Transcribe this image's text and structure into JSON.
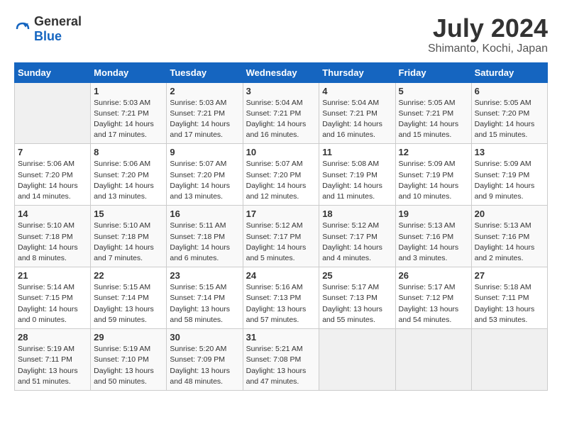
{
  "header": {
    "logo_general": "General",
    "logo_blue": "Blue",
    "title": "July 2024",
    "subtitle": "Shimanto, Kochi, Japan"
  },
  "calendar": {
    "days_of_week": [
      "Sunday",
      "Monday",
      "Tuesday",
      "Wednesday",
      "Thursday",
      "Friday",
      "Saturday"
    ],
    "weeks": [
      [
        {
          "day": "",
          "info": ""
        },
        {
          "day": "1",
          "info": "Sunrise: 5:03 AM\nSunset: 7:21 PM\nDaylight: 14 hours\nand 17 minutes."
        },
        {
          "day": "2",
          "info": "Sunrise: 5:03 AM\nSunset: 7:21 PM\nDaylight: 14 hours\nand 17 minutes."
        },
        {
          "day": "3",
          "info": "Sunrise: 5:04 AM\nSunset: 7:21 PM\nDaylight: 14 hours\nand 16 minutes."
        },
        {
          "day": "4",
          "info": "Sunrise: 5:04 AM\nSunset: 7:21 PM\nDaylight: 14 hours\nand 16 minutes."
        },
        {
          "day": "5",
          "info": "Sunrise: 5:05 AM\nSunset: 7:21 PM\nDaylight: 14 hours\nand 15 minutes."
        },
        {
          "day": "6",
          "info": "Sunrise: 5:05 AM\nSunset: 7:20 PM\nDaylight: 14 hours\nand 15 minutes."
        }
      ],
      [
        {
          "day": "7",
          "info": "Sunrise: 5:06 AM\nSunset: 7:20 PM\nDaylight: 14 hours\nand 14 minutes."
        },
        {
          "day": "8",
          "info": "Sunrise: 5:06 AM\nSunset: 7:20 PM\nDaylight: 14 hours\nand 13 minutes."
        },
        {
          "day": "9",
          "info": "Sunrise: 5:07 AM\nSunset: 7:20 PM\nDaylight: 14 hours\nand 13 minutes."
        },
        {
          "day": "10",
          "info": "Sunrise: 5:07 AM\nSunset: 7:20 PM\nDaylight: 14 hours\nand 12 minutes."
        },
        {
          "day": "11",
          "info": "Sunrise: 5:08 AM\nSunset: 7:19 PM\nDaylight: 14 hours\nand 11 minutes."
        },
        {
          "day": "12",
          "info": "Sunrise: 5:09 AM\nSunset: 7:19 PM\nDaylight: 14 hours\nand 10 minutes."
        },
        {
          "day": "13",
          "info": "Sunrise: 5:09 AM\nSunset: 7:19 PM\nDaylight: 14 hours\nand 9 minutes."
        }
      ],
      [
        {
          "day": "14",
          "info": "Sunrise: 5:10 AM\nSunset: 7:18 PM\nDaylight: 14 hours\nand 8 minutes."
        },
        {
          "day": "15",
          "info": "Sunrise: 5:10 AM\nSunset: 7:18 PM\nDaylight: 14 hours\nand 7 minutes."
        },
        {
          "day": "16",
          "info": "Sunrise: 5:11 AM\nSunset: 7:18 PM\nDaylight: 14 hours\nand 6 minutes."
        },
        {
          "day": "17",
          "info": "Sunrise: 5:12 AM\nSunset: 7:17 PM\nDaylight: 14 hours\nand 5 minutes."
        },
        {
          "day": "18",
          "info": "Sunrise: 5:12 AM\nSunset: 7:17 PM\nDaylight: 14 hours\nand 4 minutes."
        },
        {
          "day": "19",
          "info": "Sunrise: 5:13 AM\nSunset: 7:16 PM\nDaylight: 14 hours\nand 3 minutes."
        },
        {
          "day": "20",
          "info": "Sunrise: 5:13 AM\nSunset: 7:16 PM\nDaylight: 14 hours\nand 2 minutes."
        }
      ],
      [
        {
          "day": "21",
          "info": "Sunrise: 5:14 AM\nSunset: 7:15 PM\nDaylight: 14 hours\nand 0 minutes."
        },
        {
          "day": "22",
          "info": "Sunrise: 5:15 AM\nSunset: 7:14 PM\nDaylight: 13 hours\nand 59 minutes."
        },
        {
          "day": "23",
          "info": "Sunrise: 5:15 AM\nSunset: 7:14 PM\nDaylight: 13 hours\nand 58 minutes."
        },
        {
          "day": "24",
          "info": "Sunrise: 5:16 AM\nSunset: 7:13 PM\nDaylight: 13 hours\nand 57 minutes."
        },
        {
          "day": "25",
          "info": "Sunrise: 5:17 AM\nSunset: 7:13 PM\nDaylight: 13 hours\nand 55 minutes."
        },
        {
          "day": "26",
          "info": "Sunrise: 5:17 AM\nSunset: 7:12 PM\nDaylight: 13 hours\nand 54 minutes."
        },
        {
          "day": "27",
          "info": "Sunrise: 5:18 AM\nSunset: 7:11 PM\nDaylight: 13 hours\nand 53 minutes."
        }
      ],
      [
        {
          "day": "28",
          "info": "Sunrise: 5:19 AM\nSunset: 7:11 PM\nDaylight: 13 hours\nand 51 minutes."
        },
        {
          "day": "29",
          "info": "Sunrise: 5:19 AM\nSunset: 7:10 PM\nDaylight: 13 hours\nand 50 minutes."
        },
        {
          "day": "30",
          "info": "Sunrise: 5:20 AM\nSunset: 7:09 PM\nDaylight: 13 hours\nand 48 minutes."
        },
        {
          "day": "31",
          "info": "Sunrise: 5:21 AM\nSunset: 7:08 PM\nDaylight: 13 hours\nand 47 minutes."
        },
        {
          "day": "",
          "info": ""
        },
        {
          "day": "",
          "info": ""
        },
        {
          "day": "",
          "info": ""
        }
      ]
    ]
  }
}
